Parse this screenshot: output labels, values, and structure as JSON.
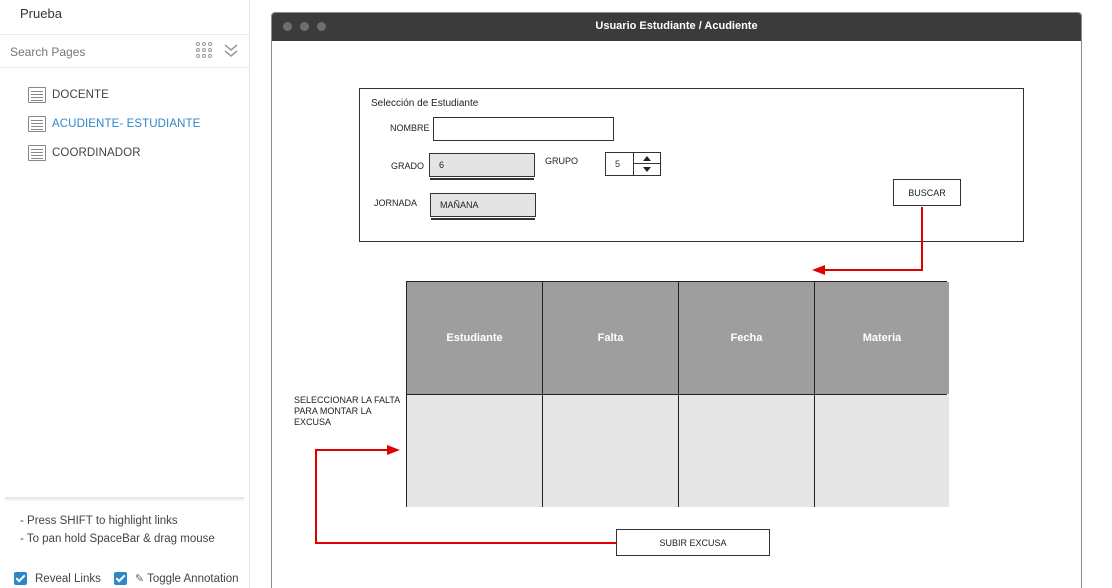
{
  "sidebar": {
    "project_title": "Prueba",
    "search_placeholder": "Search Pages",
    "pages": [
      {
        "label": "DOCENTE",
        "active": false
      },
      {
        "label": "ACUDIENTE- ESTUDIANTE",
        "active": true
      },
      {
        "label": "COORDINADOR",
        "active": false
      }
    ],
    "hints": [
      "- Press SHIFT to highlight links",
      "- To pan hold SpaceBar & drag mouse"
    ],
    "reveal_links_label": "Reveal Links",
    "reveal_links_checked": true,
    "toggle_annotation_label": "Toggle Annotation",
    "toggle_annotation_checked": true,
    "accent_color": "#2f86c7"
  },
  "window": {
    "title": "Usuario Estudiante / Acudiente"
  },
  "form": {
    "panel_title": "Selección de Estudiante",
    "nombre_label": "NOMBRE",
    "nombre_value": "",
    "grado_label": "GRADO",
    "grado_value": "6",
    "grupo_label": "GRUPO",
    "grupo_value": "5",
    "jornada_label": "JORNADA",
    "jornada_value": "MAÑANA",
    "buscar_label": "BUSCAR"
  },
  "table": {
    "headers": [
      "Estudiante",
      "Falta",
      "Fecha",
      "Materia"
    ],
    "header_color": "#9e9e9e",
    "cell_color": "#e6e6e6"
  },
  "annotation": {
    "note": "SELECCIONAR LA FALTA PARA MONTAR LA EXCUSA",
    "arrow_color": "#e00000"
  },
  "actions": {
    "subir_label": "SUBIR EXCUSA"
  }
}
